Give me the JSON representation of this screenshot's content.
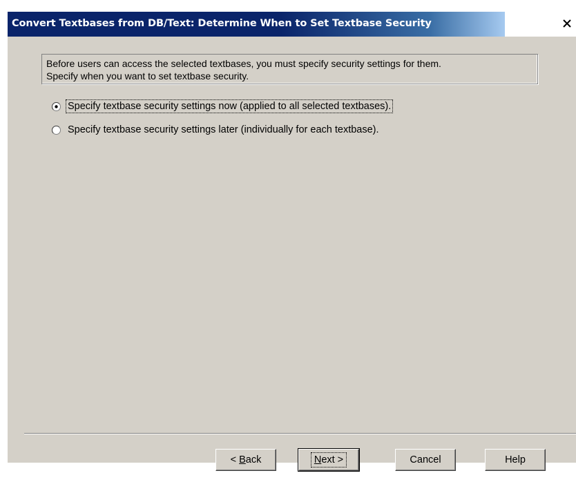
{
  "window": {
    "title": "Convert Textbases from DB/Text: Determine When to Set Textbase Security",
    "close_glyph": "✕",
    "close_icon": "close-icon"
  },
  "colors": {
    "title_bar": "#0a246a",
    "title_gradient_end": "#a6caf0",
    "dialog_face": "#d4d0c8",
    "shadow": "#808080"
  },
  "info": {
    "line1": "Before users can access the selected textbases, you must specify security settings for them.",
    "line2": "Specify when you want to set textbase security."
  },
  "options": [
    {
      "label": "Specify textbase security settings now (applied to all selected textbases).",
      "selected": true,
      "focused": true
    },
    {
      "label": "Specify textbase security settings later (individually for each textbase).",
      "selected": false,
      "focused": false
    }
  ],
  "buttons": {
    "back": {
      "mnemonic": "B",
      "rest": "ack",
      "prefix": "< "
    },
    "next": {
      "mnemonic": "N",
      "rest": "ext",
      "suffix": " >"
    },
    "cancel": "Cancel",
    "help": "Help"
  }
}
